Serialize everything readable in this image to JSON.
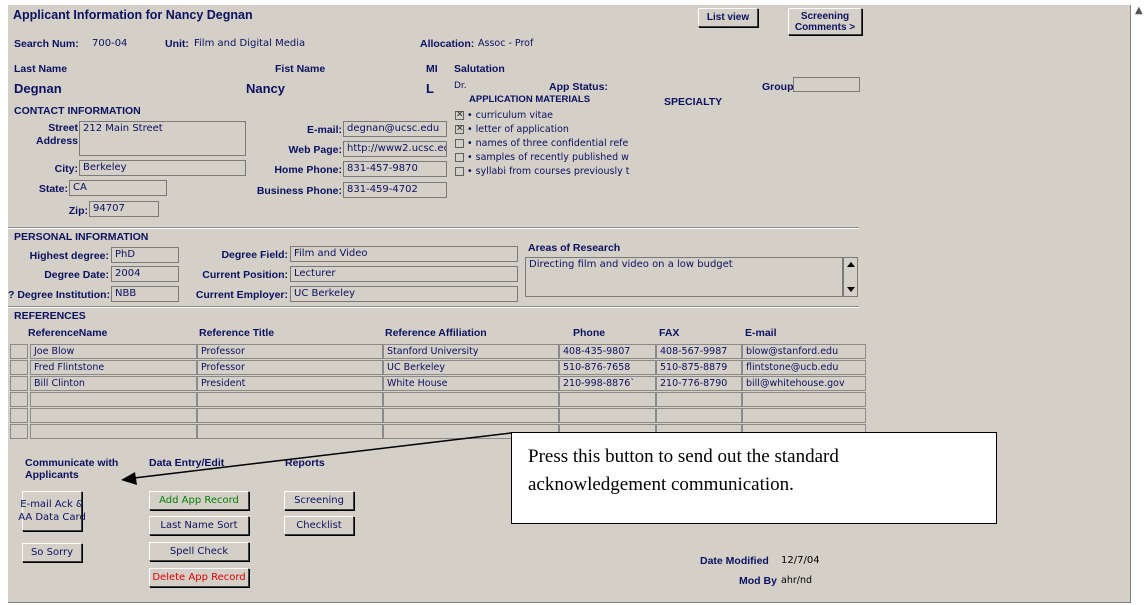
{
  "header": {
    "title": "Applicant Information for Nancy Degnan",
    "list_view": "List view",
    "screening_comments": "Screening\nComments >"
  },
  "search": {
    "search_num_label": "Search Num:",
    "search_num": "700-04",
    "unit_label": "Unit:",
    "unit": "Film and Digital Media",
    "allocation_label": "Allocation:",
    "allocation": "Assoc - Prof"
  },
  "name": {
    "last_label": "Last Name",
    "last": "Degnan",
    "first_label": "Fist Name",
    "first": "Nancy",
    "mi_label": "MI",
    "mi": "L",
    "salutation_label": "Salutation",
    "salutation": "Dr.",
    "app_status_label": "App Status:",
    "group_label": "Group:",
    "group": ""
  },
  "contact": {
    "heading": "CONTACT INFORMATION",
    "street_label": "Street\nAddress",
    "street": "212 Main Street",
    "city_label": "City:",
    "city": "Berkeley",
    "state_label": "State:",
    "state": "CA",
    "zip_label": "Zip:",
    "zip": "94707",
    "email_label": "E-mail:",
    "email": "degnan@ucsc.edu",
    "web_label": "Web Page:",
    "web": "http://www2.ucsc.ed",
    "home_phone_label": "Home Phone:",
    "home_phone": "831-457-9870",
    "business_phone_label": "Business Phone:",
    "business_phone": "831-459-4702"
  },
  "materials": {
    "heading": "APPLICATION MATERIALS",
    "specialty_label": "SPECIALTY",
    "items": [
      {
        "label": "• curriculum vitae",
        "checked": true
      },
      {
        "label": "• letter of application",
        "checked": true
      },
      {
        "label": "• names of three confidential refe",
        "checked": false
      },
      {
        "label": "• samples of recently published w",
        "checked": false
      },
      {
        "label": "• syllabi from courses previously t",
        "checked": false
      }
    ]
  },
  "personal": {
    "heading": "PERSONAL INFORMATION",
    "highest_degree_label": "Highest degree:",
    "highest_degree": "PhD",
    "degree_date_label": "Degree Date:",
    "degree_date": "2004",
    "degree_inst_label": "? Degree Institution:",
    "degree_inst": "NBB",
    "degree_field_label": "Degree Field:",
    "degree_field": "Film and Video",
    "current_position_label": "Current Position:",
    "current_position": "Lecturer",
    "current_employer_label": "Current Employer:",
    "current_employer": "UC Berkeley",
    "research_label": "Areas of Research",
    "research": "Directing film and video on a low budget"
  },
  "references": {
    "heading": "REFERENCES",
    "columns": [
      "ReferenceName",
      "Reference Title",
      "Reference Affiliation",
      "Phone",
      "FAX",
      "E-mail"
    ],
    "rows": [
      [
        "Joe Blow",
        "Professor",
        "Stanford University",
        "408-435-9807",
        "408-567-9987",
        "blow@stanford.edu"
      ],
      [
        "Fred Flintstone",
        "Professor",
        "UC Berkeley",
        "510-876-7658",
        "510-875-8879",
        "flintstone@ucb.edu"
      ],
      [
        "Bill Clinton",
        "President",
        "White House",
        "210-998-8876`",
        "210-776-8790",
        "bill@whitehouse.gov"
      ],
      [
        "",
        "",
        "",
        "",
        "",
        ""
      ],
      [
        "",
        "",
        "",
        "",
        "",
        ""
      ],
      [
        "",
        "",
        "",
        "",
        "",
        ""
      ]
    ]
  },
  "actions": {
    "communicate_heading": "Communicate with\nApplicants",
    "data_entry_heading": "Data Entry/Edit",
    "reports_heading": "Reports",
    "email_ack": "E-mail Ack &\nAA Data Card",
    "so_sorry": "So Sorry",
    "add_app_record": "Add App Record",
    "last_name_sort": "Last Name Sort",
    "spell_check": "Spell Check",
    "delete_app_record": "Delete App Record",
    "screening": "Screening",
    "checklist": "Checklist"
  },
  "footer": {
    "date_modified_label": "Date Modified",
    "date_modified": "12/7/04",
    "mod_by_label": "Mod By",
    "mod_by": "ahr/nd"
  },
  "callout": {
    "text": "Press this button to send out the standard acknowledgement communication."
  },
  "colors": {
    "form_bg": "#d4d0c8",
    "label_navy": "#0b1060",
    "add_green": "#008000",
    "delete_red": "#e00000"
  }
}
